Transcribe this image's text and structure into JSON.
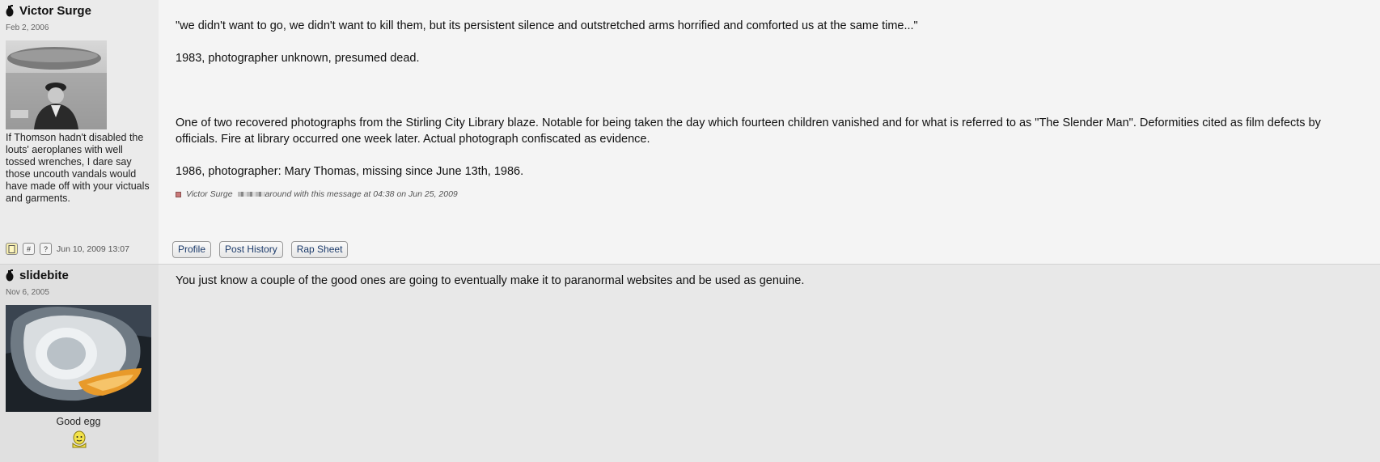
{
  "posts": [
    {
      "username": "Victor Surge",
      "regdate": "Feb 2, 2006",
      "usertitle": "If Thomson hadn't disabled the louts' aeroplanes with well tossed wrenches, I dare say those uncouth vandals would have made off with your victuals and garments.",
      "paragraphs": [
        "\"we didn't want to go, we didn't want to kill them, but its persistent silence and outstretched arms horrified and comforted us at the same time...\"",
        "1983, photographer unknown, presumed dead.",
        "One of two recovered photographs from the Stirling City Library blaze. Notable for being taken the day which fourteen children vanished and for what is referred to as \"The Slender Man\". Deformities cited as film defects by officials. Fire at library occurred one week later. Actual photograph confiscated as evidence.",
        "1986, photographer: Mary Thomas, missing since June 13th, 1986."
      ],
      "edit_note_user": "Victor Surge",
      "edit_note_text": "around with this message at 04:38 on Jun 25, 2009",
      "footer_buttons": [
        "#",
        "?"
      ],
      "post_date": "Jun 10, 2009 13:07",
      "profile_links": [
        "Profile",
        "Post History",
        "Rap Sheet"
      ]
    },
    {
      "username": "slidebite",
      "regdate": "Nov 6, 2005",
      "usertitle": "Good egg",
      "paragraphs": [
        "You just know a couple of the good ones are going to eventually make it to paranormal websites and be used as genuine."
      ]
    }
  ],
  "icons": {
    "user_icon": "grenade-icon",
    "title_icon": "good-egg-icon",
    "edit_marker": "edit-square-icon",
    "bookmark": "document-icon"
  }
}
